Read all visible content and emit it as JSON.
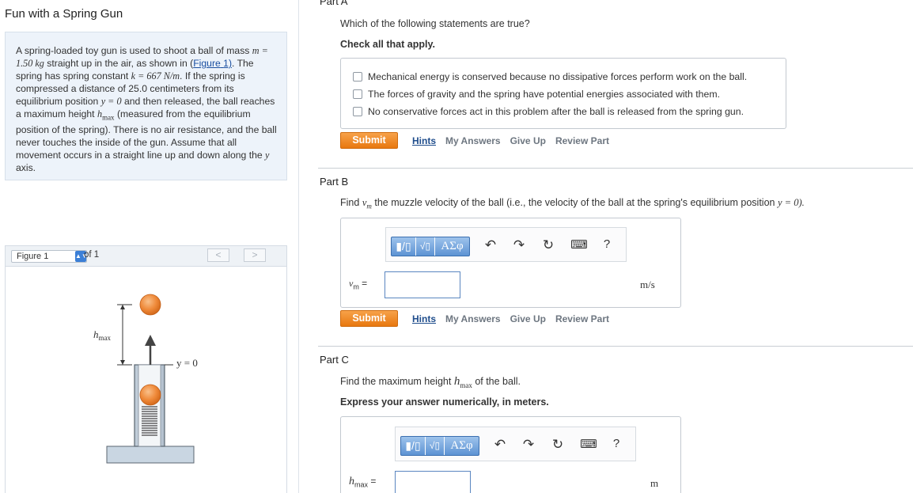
{
  "problem": {
    "title": "Fun with a Spring Gun",
    "text_1": "A spring-loaded toy gun is used to shoot a ball of mass",
    "mass": "m = 1.50 kg",
    "text_2": "straight up in the air, as shown in (",
    "figure_link_1": "Figure",
    "figure_link_2": "1)",
    "text_3": ". The spring has spring constant",
    "spring_const": "k = 667 N/m",
    "text_4": ". If the spring is compressed a distance of 25.0 centimeters from its equilibrium position",
    "eq_pos": "y = 0",
    "text_5": "and then released, the ball reaches a maximum height",
    "hmax_sym": "h",
    "hmax_sub": "max",
    "text_6": "(measured from the equilibrium position of the spring). There is no air resistance, and the ball never touches the inside of the gun. Assume that all movement occurs in a straight line up and down along the",
    "y_axis": "y",
    "text_7": "axis."
  },
  "figure": {
    "select_value": "Figure 1",
    "of_label": "of 1",
    "prev": "<",
    "next": ">",
    "hmax_label": "h",
    "hmax_sub": "max",
    "y0_label": "y = 0"
  },
  "part_a": {
    "label": "Part A",
    "question": "Which of the following statements are true?",
    "instruction": "Check all that apply.",
    "choices": [
      "Mechanical energy is conserved because no dissipative forces perform work on the ball.",
      "The forces of gravity and the spring have potential energies associated with them.",
      "No conservative forces act in this problem after the ball is released from the spring gun."
    ]
  },
  "part_b": {
    "label": "Part B",
    "q_1": "Find",
    "var": "v",
    "var_sub": "m",
    "q_2": "the muzzle velocity of the ball (i.e., the velocity of the ball at the spring's equilibrium position",
    "eq": "y = 0).",
    "input_label": "v",
    "input_sub": "m",
    "equals": "=",
    "unit": "m/s",
    "input_value": ""
  },
  "part_c": {
    "label": "Part C",
    "q_1": "Find the maximum height",
    "var": "h",
    "var_sub": "max",
    "q_2": "of the ball.",
    "instruction": "Express your answer numerically, in meters.",
    "input_label": "h",
    "input_sub": "max",
    "equals": "=",
    "unit": "m",
    "input_value": ""
  },
  "actions": {
    "submit": "Submit",
    "hints": "Hints",
    "my_answers": "My Answers",
    "give_up": "Give Up",
    "review_part": "Review Part"
  },
  "toolbar": {
    "greek": "ΑΣφ",
    "help": "?"
  }
}
